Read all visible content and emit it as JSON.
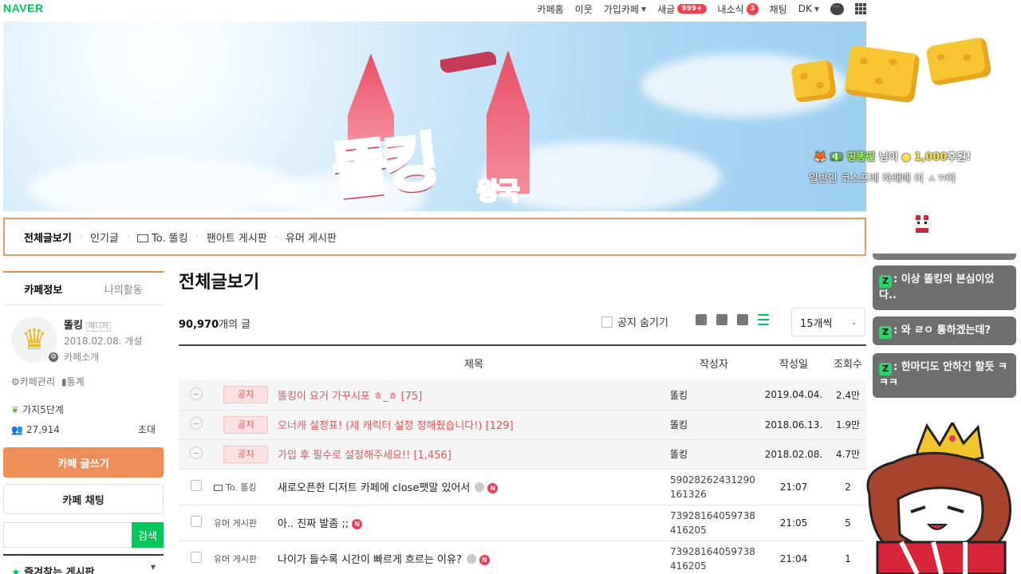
{
  "topbar": {
    "logo": "NAVER",
    "nav": {
      "cafe_home": "카페홈",
      "neighbors": "이웃",
      "joined_cafe": "가입카페",
      "new_posts": "새글",
      "new_posts_badge": "999+",
      "my_news": "내소식",
      "my_news_badge": "3",
      "chat": "채팅",
      "user": "DK"
    }
  },
  "banner": {
    "title": "똘킹",
    "subtitle": "왕국"
  },
  "tabs": [
    {
      "label": "전체글보기"
    },
    {
      "label": "인기글"
    },
    {
      "label": "To. 똘킹"
    },
    {
      "label": "팬아트 게시판"
    },
    {
      "label": "유머 게시판"
    }
  ],
  "sidebar": {
    "tab_info": "카페정보",
    "tab_activity": "나의활동",
    "manager_name": "똘킹",
    "manager_badge": "매니저",
    "founded": "2018.02.08. 개설",
    "intro": "카페소개",
    "manage": "카페관리",
    "stats": "통계",
    "level": "가지5단계",
    "members": "27,914",
    "invite": "초대",
    "write_button": "카페 글쓰기",
    "chat_button": "카페 채팅",
    "search_button": "검색",
    "favorites": "즐겨찾는 게시판"
  },
  "main": {
    "title": "전체글보기",
    "post_count": "90,970",
    "post_count_suffix": "개의 글",
    "hide_notice": "공지 숨기기",
    "per_page": "15개씩",
    "columns": {
      "title": "제목",
      "author": "작성자",
      "date": "작성일",
      "views": "조회수"
    },
    "notices": [
      {
        "tag": "공지",
        "title": "똘킹이 요거 가꾸시포 ㅎ_ㅎ [75]",
        "author": "똘킹",
        "date": "2019.04.04.",
        "views": "2.4만"
      },
      {
        "tag": "공지",
        "title": "오너캐 설정표! (제 캐릭터 설정 정해줬습니다!) [129]",
        "author": "똘킹",
        "date": "2018.06.13.",
        "views": "1.9만"
      },
      {
        "tag": "공지",
        "title": "가입 후 필수로 설정해주세요!! [1,456]",
        "author": "똘킹",
        "date": "2018.02.08.",
        "views": "4.7만"
      }
    ],
    "posts": [
      {
        "category": "To. 똘킹",
        "title": "새로오픈한 디저트 카페에 close팻말 있어서",
        "author_line1": "59028262431290",
        "author_line2": "161326",
        "date": "21:07",
        "views": "2"
      },
      {
        "category": "유머 게시판",
        "title": "아.. 진짜 발좀 ;;",
        "author_line1": "73928164059738",
        "author_line2": "416205",
        "date": "21:05",
        "views": "5"
      },
      {
        "category": "유머 게시판",
        "title": "나이가 들수록 시간이 빠르게 흐르는 이유?",
        "author_line1": "73928164059738",
        "author_line2": "416205",
        "date": "21:04",
        "views": "1"
      }
    ]
  },
  "overlay": {
    "donation_user": "띵똥띤",
    "donation_mid": "님이",
    "donation_amount": "1,000",
    "donation_suffix": "후원!",
    "donation_message": "일반인 코스프레 하래매 이 ㅅㄲ야",
    "chat_messages": [
      {
        "text": ": 이상 똘킹의 본심이었다.."
      },
      {
        "text": ": 와 ㄹㅇ 통하겠는데?"
      },
      {
        "text": ": 한마디도 안하긴 할듯 ㅋㅋㅋ"
      }
    ],
    "chat_prefix_icon": "Z"
  }
}
